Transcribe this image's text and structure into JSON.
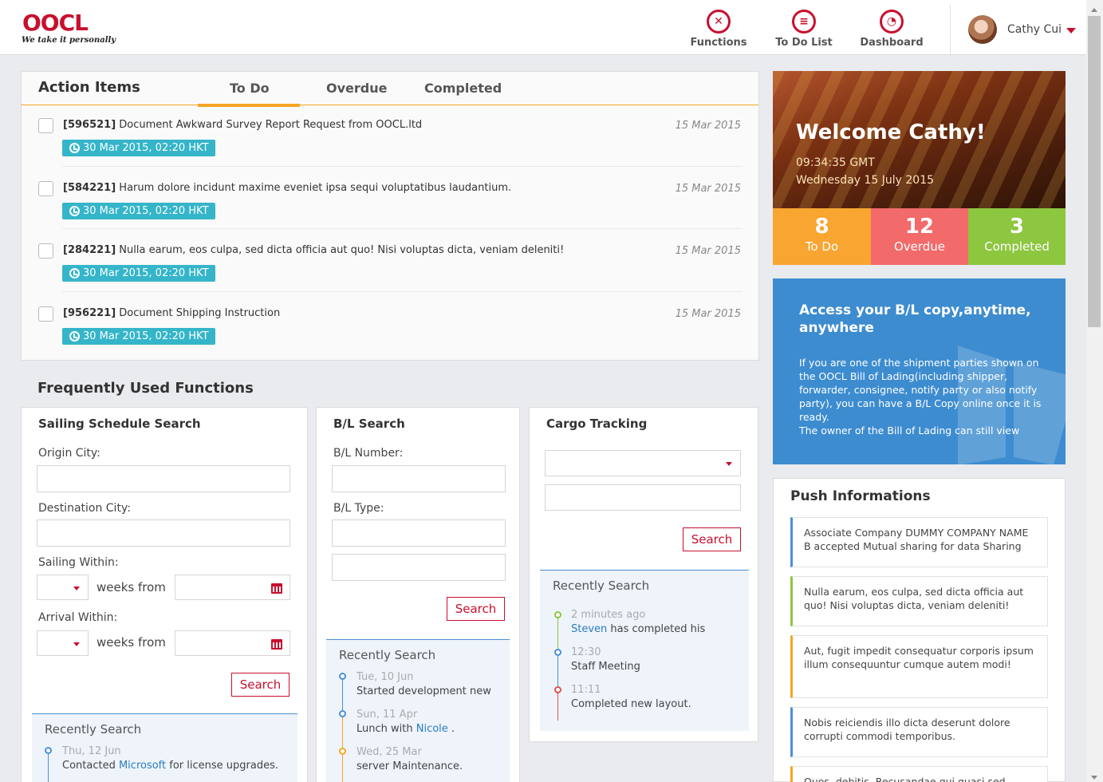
{
  "brand": {
    "logo": "OOCL",
    "tagline": "We take it personally",
    "color": "#c8102e"
  },
  "nav": [
    {
      "label": "Functions",
      "icon": "functions-icon"
    },
    {
      "label": "To Do List",
      "icon": "todo-list-icon"
    },
    {
      "label": "Dashboard",
      "icon": "dashboard-icon"
    }
  ],
  "user": {
    "name": "Cathy Cui"
  },
  "action_items": {
    "title": "Action Items",
    "tabs": [
      "To Do",
      "Overdue",
      "Completed"
    ],
    "active_tab": "To Do",
    "items": [
      {
        "id": "[596521]",
        "text": "Document Awkward Survey Report Request from OOCL.ltd",
        "date": "15 Mar 2015",
        "deadline": "30 Mar 2015, 02:20 HKT"
      },
      {
        "id": "[584221]",
        "text": "Harum dolore incidunt maxime eveniet ipsa sequi voluptatibus laudantium.",
        "date": "15 Mar 2015",
        "deadline": "30 Mar 2015, 02:20 HKT"
      },
      {
        "id": "[284221]",
        "text": "Nulla earum, eos culpa, sed dicta officia aut quo! Nisi voluptas dicta, veniam deleniti!",
        "date": "15 Mar 2015",
        "deadline": "30 Mar 2015, 02:20 HKT"
      },
      {
        "id": "[956221]",
        "text": "Document Shipping Instruction",
        "date": "15 Mar 2015",
        "deadline": "30 Mar 2015, 02:20 HKT"
      }
    ]
  },
  "functions": {
    "title": "Frequently Used Functions",
    "sailing": {
      "title": "Sailing Schedule Search",
      "origin_label": "Origin City:",
      "destination_label": "Destination City:",
      "sailing_within_label": "Sailing Within:",
      "arrival_within_label": "Arrival Within:",
      "weeks_from": "weeks from",
      "search": "Search",
      "recent_title": "Recently Search",
      "recent": [
        {
          "time": "Thu, 12 Jun",
          "pre": "Contacted ",
          "link": "Microsoft",
          "post": " for license upgrades."
        }
      ]
    },
    "bl": {
      "title": "B/L Search",
      "number_label": "B/L Number:",
      "type_label": "B/L Type:",
      "search": "Search",
      "recent_title": "Recently Search",
      "recent": [
        {
          "time": "Tue, 10 Jun",
          "pre": "Started development new",
          "link": "",
          "post": ""
        },
        {
          "time": "Sun, 11 Apr",
          "pre": "Lunch with ",
          "link": "Nicole",
          "post": " ."
        },
        {
          "time": "Wed, 25 Mar",
          "pre": "server Maintenance.",
          "link": "",
          "post": ""
        }
      ]
    },
    "cargo": {
      "title": "Cargo Tracking",
      "search": "Search",
      "recent_title": "Recently Search",
      "recent": [
        {
          "time": "2 minutes ago",
          "pre": "",
          "link": "Steven",
          "post": " has completed his"
        },
        {
          "time": "12:30",
          "pre": "Staff Meeting",
          "link": "",
          "post": ""
        },
        {
          "time": "11:11",
          "pre": "Completed new layout.",
          "link": "",
          "post": ""
        }
      ]
    }
  },
  "welcome": {
    "title": "Welcome Cathy!",
    "time": "09:34:35 GMT",
    "date": "Wednesday 15 July 2015",
    "stats": [
      {
        "value": "8",
        "label": "To Do",
        "color": "#f9a531"
      },
      {
        "value": "12",
        "label": "Overdue",
        "color": "#f26a6a"
      },
      {
        "value": "3",
        "label": "Completed",
        "color": "#8dc63f"
      }
    ]
  },
  "bl_promo": {
    "heading": "Access your B/L copy,anytime, anywhere",
    "body": "If you are one of the shipment parties shown on the OOCL Bill of Lading(including shipper, forwarder, consignee, notify party or also notify party), you can have a B/L Copy online once it is ready.",
    "body2": "The owner of the Bill of Lading can still view"
  },
  "push": {
    "title": "Push Informations",
    "items": [
      {
        "text": "Associate Company DUMMY COMPANY NAME B accepted Mutual sharing for data Sharing",
        "color": "#4a90d9"
      },
      {
        "text": "Nulla earum, eos culpa, sed dicta officia aut quo! Nisi voluptas dicta, veniam deleniti!",
        "color": "#8dc63f"
      },
      {
        "text": "Aut, fugit impedit consequatur corporis ipsum illum consequuntur cumque autem modi!",
        "color": "#f5a623"
      },
      {
        "text": "Nobis reiciendis illo dicta deserunt dolore corrupti commodi temporibus.",
        "color": "#4a90d9"
      },
      {
        "text": "Quos, debitis. Recusandae qui quasi sed",
        "color": "#f5a623"
      }
    ]
  }
}
